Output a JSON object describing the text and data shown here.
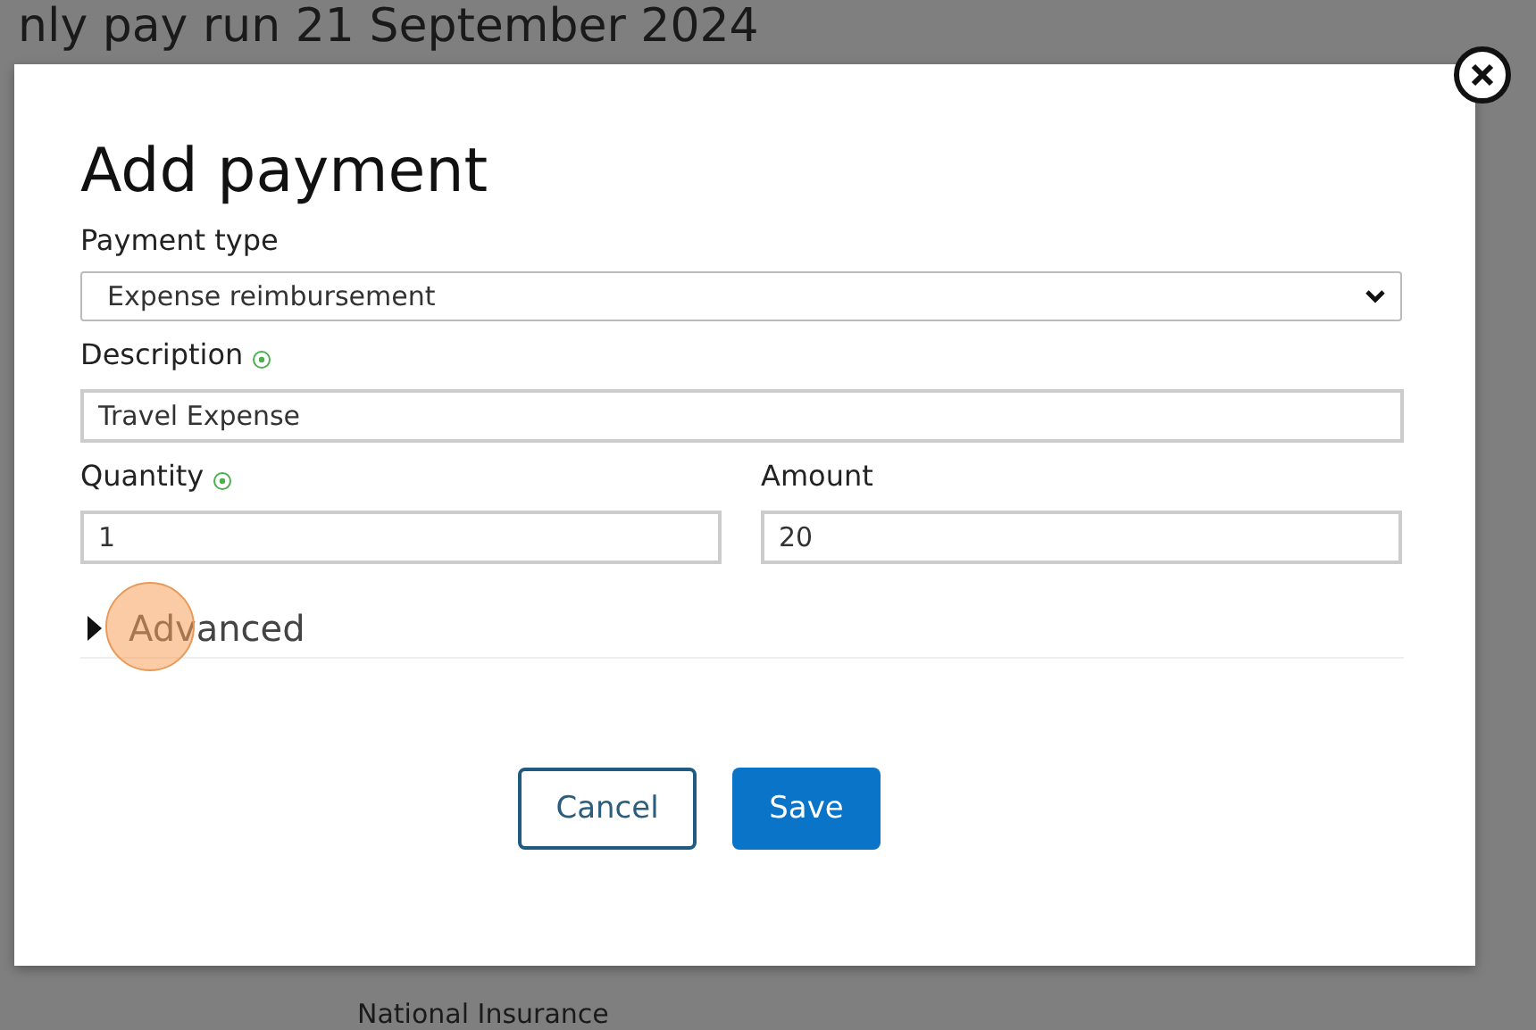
{
  "background": {
    "heading": "nly pay run 21 September 2024",
    "row_label": "National Insurance"
  },
  "dialog": {
    "title": "Add payment",
    "payment_type": {
      "label": "Payment type",
      "value": "Expense reimbursement"
    },
    "description": {
      "label": "Description",
      "value": "Travel Expense"
    },
    "quantity": {
      "label": "Quantity",
      "value": "1"
    },
    "amount": {
      "label": "Amount",
      "value": "20"
    },
    "advanced": {
      "label": "Advanced",
      "expanded": false
    },
    "buttons": [
      {
        "label": "Cancel",
        "kind": "secondary"
      },
      {
        "label": "Save",
        "kind": "primary"
      }
    ]
  }
}
